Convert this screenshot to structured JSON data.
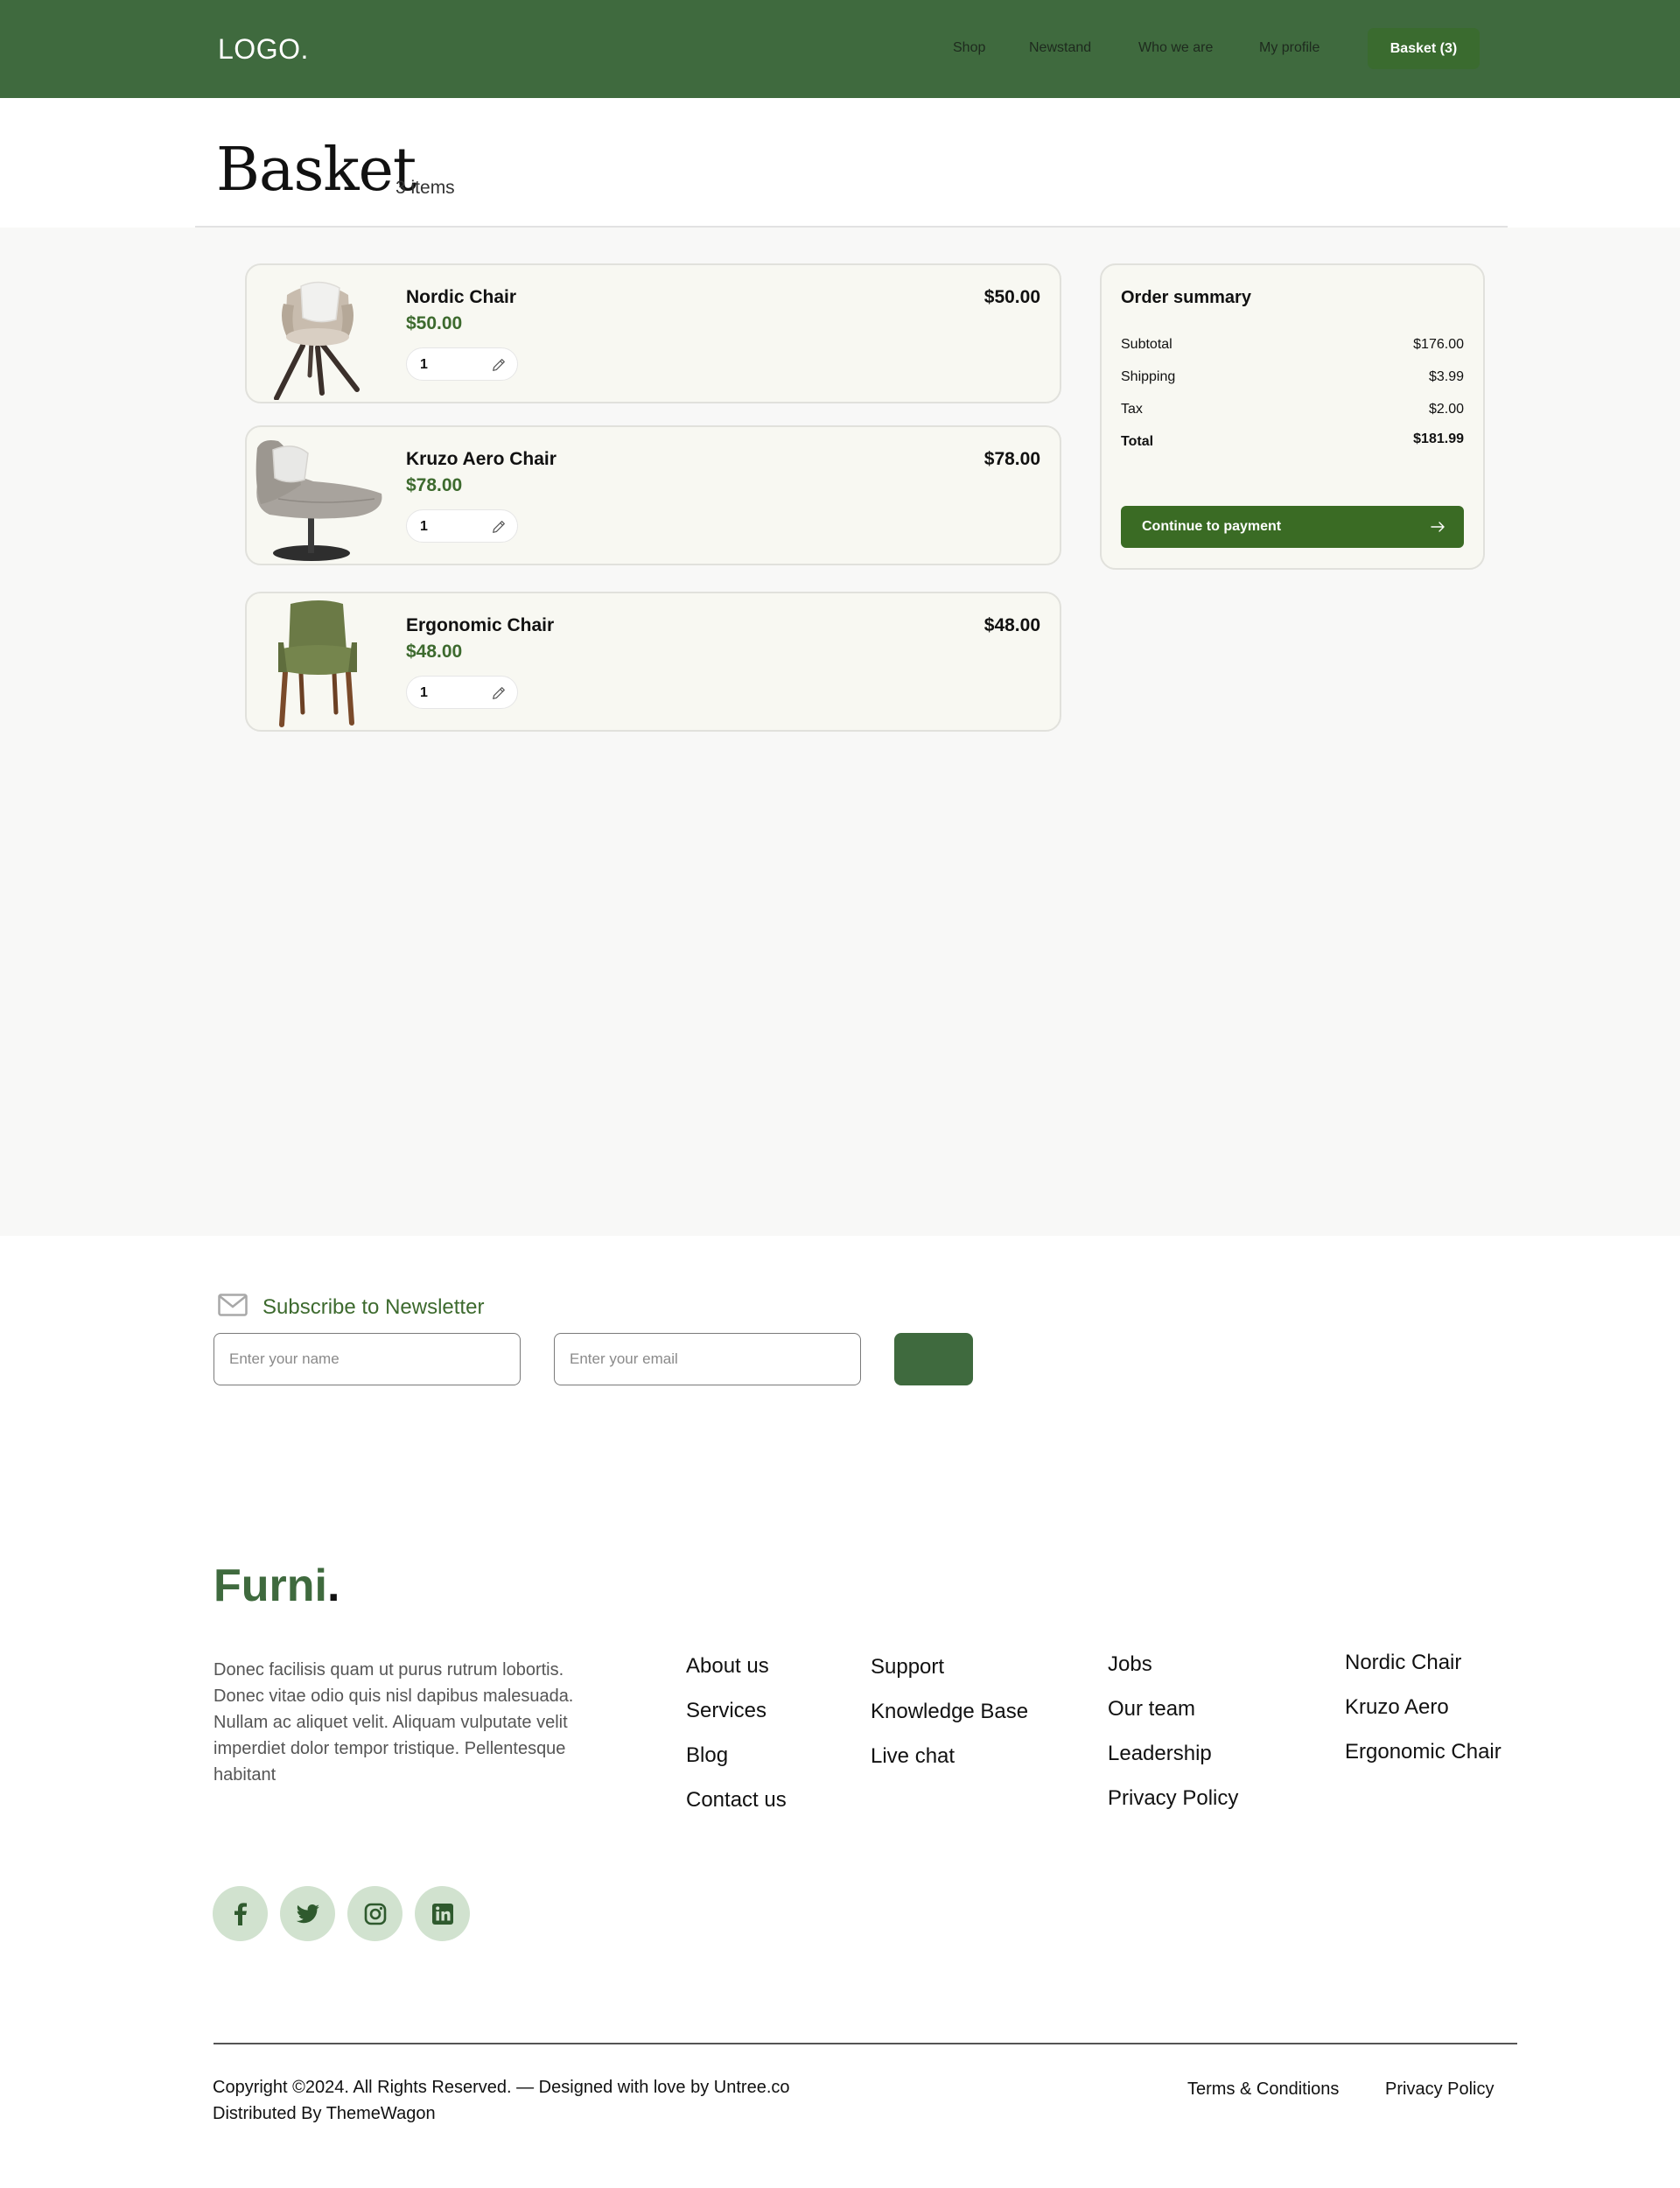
{
  "header": {
    "logo": "LOGO.",
    "nav": [
      "Shop",
      "Newstand",
      "Who we are",
      "My profile"
    ],
    "basket_button": "Basket (3)"
  },
  "page": {
    "title": "Basket",
    "items_count": "3 items"
  },
  "cart": {
    "items": [
      {
        "name": "Nordic Chair",
        "price": "$50.00",
        "quantity": "1",
        "total": "$50.00"
      },
      {
        "name": "Kruzo Aero Chair",
        "price": "$78.00",
        "quantity": "1",
        "total": "$78.00"
      },
      {
        "name": "Ergonomic Chair",
        "price": "$48.00",
        "quantity": "1",
        "total": "$48.00"
      }
    ]
  },
  "summary": {
    "title": "Order summary",
    "rows": [
      {
        "label": "Subtotal",
        "value": "$176.00"
      },
      {
        "label": "Shipping",
        "value": "$3.99"
      },
      {
        "label": "Tax",
        "value": "$2.00"
      },
      {
        "label": "Total",
        "value": "$181.99"
      }
    ],
    "button": "Continue to payment"
  },
  "newsletter": {
    "title": "Subscribe to Newsletter",
    "name_placeholder": "Enter your name",
    "email_placeholder": "Enter your email"
  },
  "footer": {
    "brand": "Furni",
    "brand_dot": ".",
    "about": "Donec facilisis quam ut purus rutrum lobortis. Donec vitae odio quis nisl dapibus malesuada. Nullam ac aliquet velit. Aliquam vulputate velit imperdiet dolor tempor tristique. Pellentesque habitant",
    "columns": [
      [
        "About us",
        "Services",
        "Blog",
        "Contact us"
      ],
      [
        "Support",
        "Knowledge Base",
        "Live chat"
      ],
      [
        "Jobs",
        "Our team",
        "Leadership",
        "Privacy Policy"
      ],
      [
        "Nordic Chair",
        "Kruzo Aero",
        "Ergonomic Chair"
      ]
    ],
    "social": [
      "facebook-icon",
      "twitter-icon",
      "instagram-icon",
      "linkedin-icon"
    ],
    "copyright_line1": "Copyright ©2024. All Rights Reserved. — Designed with love by Untree.co",
    "copyright_line2": "Distributed By ThemeWagon",
    "legal": [
      "Terms & Conditions",
      "Privacy Policy"
    ]
  },
  "colors": {
    "header_bg": "#3f6a3e",
    "accent_green": "#3d6a2e",
    "pay_button": "#3a6b24",
    "social_bg": "#d1e2cf"
  }
}
